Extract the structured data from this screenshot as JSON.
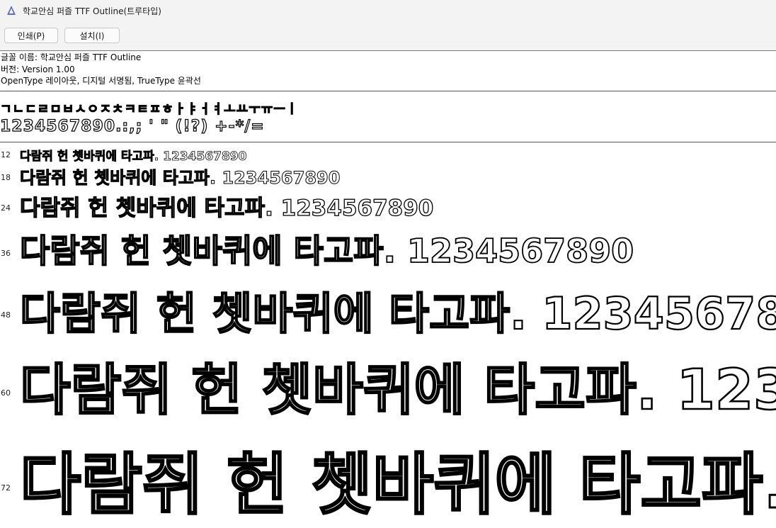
{
  "window": {
    "title": "학교안심 퍼즐 TTF Outline(트루타입)"
  },
  "toolbar": {
    "print_label": "인쇄(P)",
    "install_label": "설치(I)"
  },
  "info": {
    "name_line": "글꼴 이름: 학교안심 퍼즐 TTF Outline",
    "version_line": "버전: Version 1.00",
    "type_line": "OpenType 레이아웃, 디지털 서명됨, TrueType 윤곽선"
  },
  "charset": {
    "jamo_line": "ㄱㄴㄷㄹㅁㅂㅅㅇㅈㅊㅋㅌㅍㅎㅏㅑㅓㅕㅗㅛㅜㅠㅡㅣ",
    "symbols_line": "1234567890.:,; ' \" (!?) +-*/="
  },
  "preview": {
    "text": "다람쥐 헌 쳇바퀴에 타고파. 1234567890",
    "rows": [
      {
        "size_label": "12"
      },
      {
        "size_label": "18"
      },
      {
        "size_label": "24"
      },
      {
        "size_label": "36"
      },
      {
        "size_label": "48"
      },
      {
        "size_label": "60"
      },
      {
        "size_label": "72"
      }
    ]
  }
}
